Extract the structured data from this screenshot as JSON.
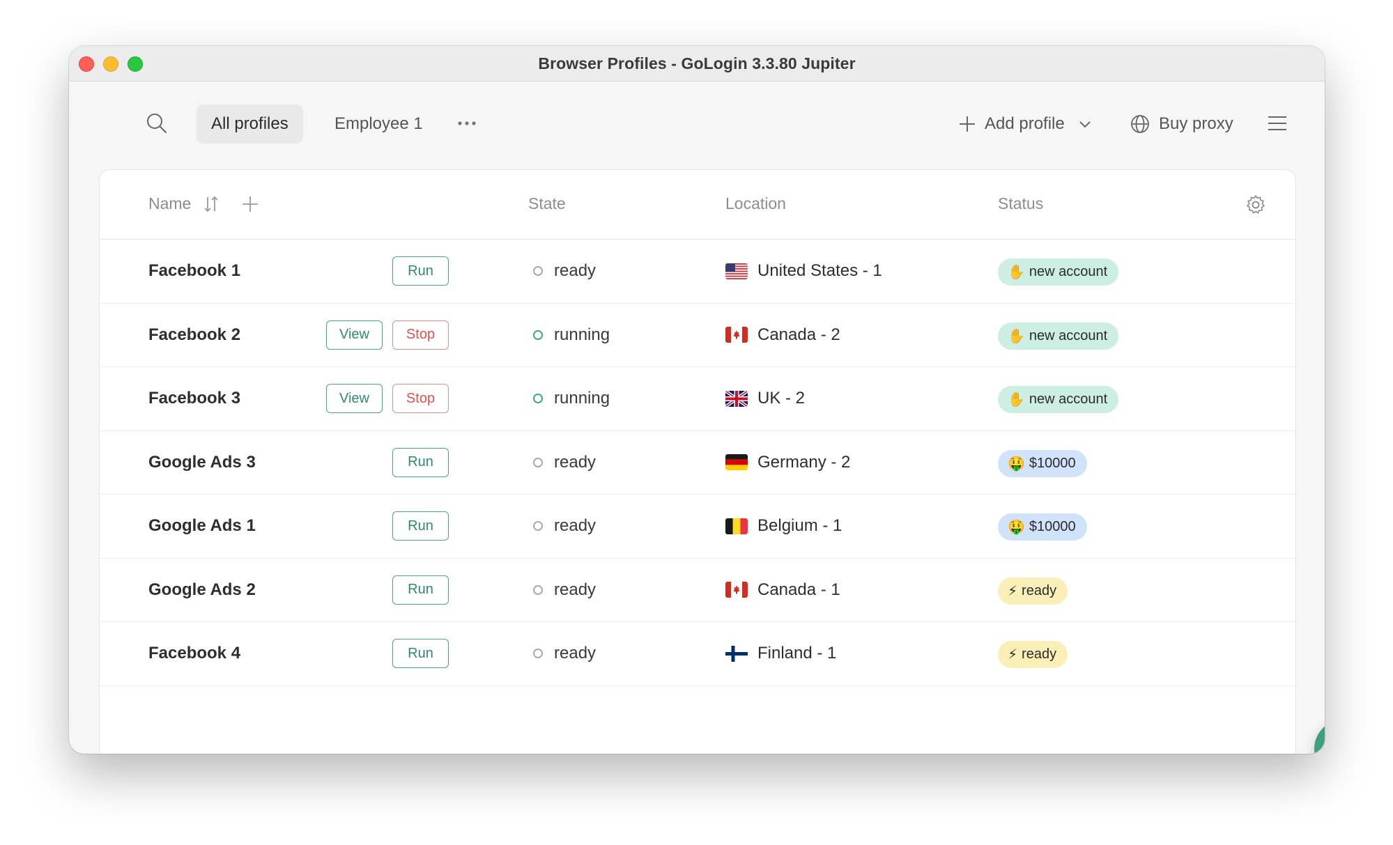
{
  "window": {
    "title": "Browser Profiles - GoLogin 3.3.80 Jupiter"
  },
  "toolbar": {
    "tabs": [
      "All profiles",
      "Employee 1"
    ],
    "add_profile_label": "Add profile",
    "buy_proxy_label": "Buy proxy"
  },
  "table": {
    "headers": {
      "name": "Name",
      "state": "State",
      "location": "Location",
      "status": "Status"
    },
    "rows": [
      {
        "name": "Facebook 1",
        "actions": [
          "Run"
        ],
        "state": "ready",
        "location": "United States - 1",
        "flag": "us-flag",
        "status": "new account",
        "status_icon": "✋",
        "status_color": "#cdeee2"
      },
      {
        "name": "Facebook 2",
        "actions": [
          "View",
          "Stop"
        ],
        "state": "running",
        "location": "Canada - 2",
        "flag": "ca-flag",
        "status": "new account",
        "status_icon": "✋",
        "status_color": "#cdeee2"
      },
      {
        "name": "Facebook 3",
        "actions": [
          "View",
          "Stop"
        ],
        "state": "running",
        "location": "UK - 2",
        "flag": "uk-flag",
        "status": "new account",
        "status_icon": "✋",
        "status_color": "#cdeee2"
      },
      {
        "name": "Google Ads 3",
        "actions": [
          "Run"
        ],
        "state": "ready",
        "location": "Germany - 2",
        "flag": "de-flag",
        "status": "$10000",
        "status_icon": "🤑",
        "status_color": "#d1e3fb"
      },
      {
        "name": "Google Ads 1",
        "actions": [
          "Run"
        ],
        "state": "ready",
        "location": "Belgium - 1",
        "flag": "be-flag",
        "status": "$10000",
        "status_icon": "🤑",
        "status_color": "#d1e3fb"
      },
      {
        "name": "Google Ads 2",
        "actions": [
          "Run"
        ],
        "state": "ready",
        "location": "Canada - 1",
        "flag": "ca-flag",
        "status": "ready",
        "status_icon": "⚡",
        "status_color": "#fbefb8"
      },
      {
        "name": "Facebook 4",
        "actions": [
          "Run"
        ],
        "state": "ready",
        "location": "Finland - 1",
        "flag": "fi-flag",
        "status": "ready",
        "status_icon": "⚡",
        "status_color": "#fbefb8"
      }
    ]
  },
  "colors": {
    "accent": "#3f9f7e",
    "stop": "#d9534f",
    "header_text": "#8d8d8d"
  },
  "icons": [
    "search-icon",
    "more-icon",
    "plus-icon",
    "chevron-down-icon",
    "globe-icon",
    "menu-icon",
    "sort-icon",
    "add-column-icon",
    "gear-icon",
    "chat-icon"
  ]
}
